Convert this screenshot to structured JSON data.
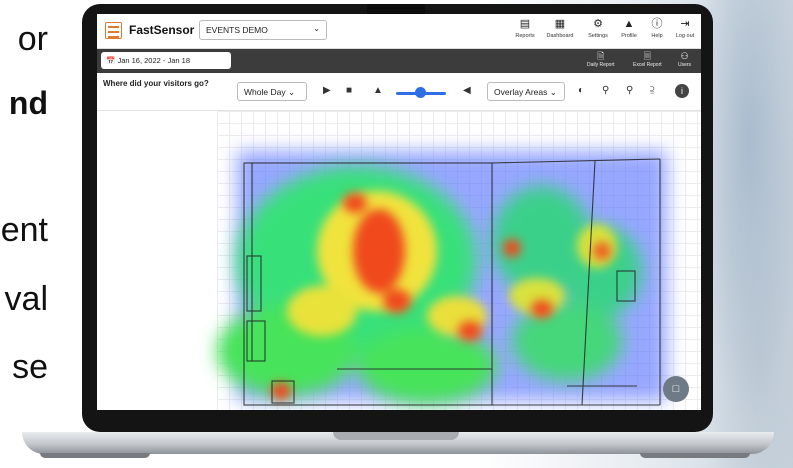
{
  "side_text": [
    "or",
    "nd",
    "ent",
    "val",
    "se"
  ],
  "app": {
    "name": "FastSensor",
    "event_selector": "EVENTS DEMO",
    "nav": [
      {
        "label": "Reports",
        "icon": "reports-icon"
      },
      {
        "label": "Dashboard",
        "icon": "dashboard-icon"
      },
      {
        "label": "Settings",
        "icon": "gear-icon"
      },
      {
        "label": "Profile",
        "icon": "profile-icon"
      },
      {
        "label": "Help",
        "icon": "help-icon"
      },
      {
        "label": "Log out",
        "icon": "logout-icon"
      }
    ]
  },
  "date_bar": {
    "date_range": "Jan 16, 2022 - Jan 18",
    "actions": [
      {
        "label": "Daily Report",
        "icon": "daily-report-icon"
      },
      {
        "label": "Excel Report",
        "icon": "excel-report-icon"
      },
      {
        "label": "Users",
        "icon": "users-icon"
      }
    ]
  },
  "toolbar": {
    "question": "Where did your visitors go?",
    "time_select": "Whole Day",
    "overlay_select": "Overlay Areas",
    "slider_value": 0.6
  },
  "colors": {
    "accent": "#2f6fe6",
    "logo": "#e07a2e",
    "dark_bar": "#3c3c3c"
  }
}
